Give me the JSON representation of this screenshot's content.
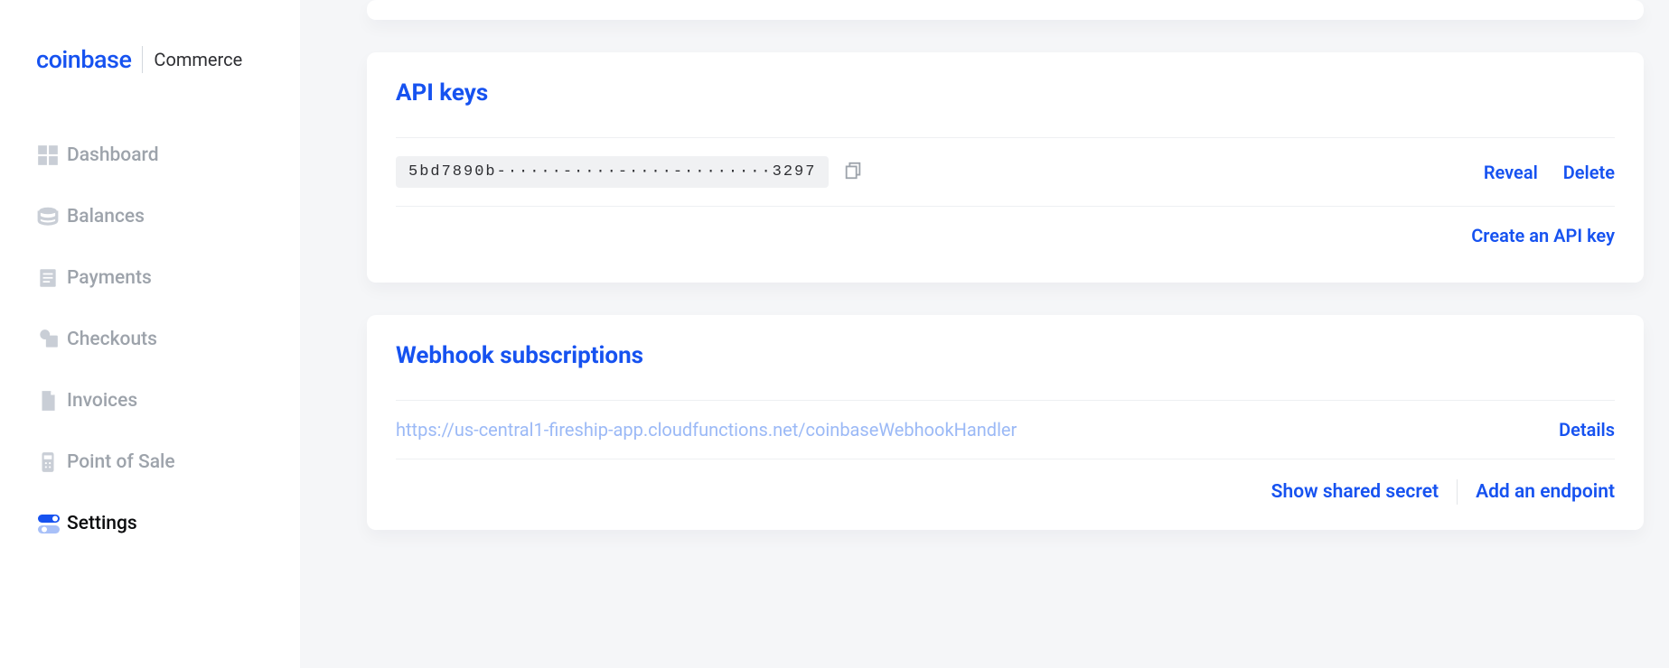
{
  "logo": {
    "brand": "coinbase",
    "sub": "Commerce"
  },
  "sidebar": {
    "items": [
      {
        "label": "Dashboard"
      },
      {
        "label": "Balances"
      },
      {
        "label": "Payments"
      },
      {
        "label": "Checkouts"
      },
      {
        "label": "Invoices"
      },
      {
        "label": "Point of Sale"
      },
      {
        "label": "Settings"
      }
    ]
  },
  "api_keys": {
    "title": "API keys",
    "key_masked": "5bd7890b-·····-····-····-········3297",
    "reveal": "Reveal",
    "delete": "Delete",
    "create": "Create an API key"
  },
  "webhooks": {
    "title": "Webhook subscriptions",
    "url": "https://us-central1-fireship-app.cloudfunctions.net/coinbaseWebhookHandler",
    "details": "Details",
    "show_secret": "Show shared secret",
    "add_endpoint": "Add an endpoint"
  }
}
